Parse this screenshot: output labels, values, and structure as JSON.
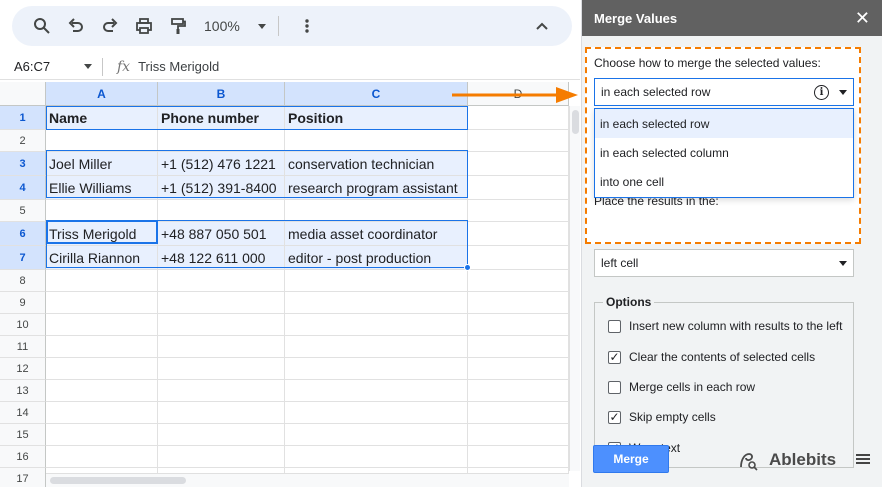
{
  "toolbar": {
    "zoom": "100%"
  },
  "formula_bar": {
    "name_box": "A6:C7",
    "fx": "fx",
    "value": "Triss Merigold"
  },
  "columns": [
    "A",
    "B",
    "C",
    "D"
  ],
  "rows": [
    {
      "num": "1",
      "cells": [
        "Name",
        "Phone number",
        "Position"
      ]
    },
    {
      "num": "2",
      "cells": [
        "",
        "",
        ""
      ]
    },
    {
      "num": "3",
      "cells": [
        "Joel Miller",
        "+1 (512) 476 1221",
        "conservation technician"
      ]
    },
    {
      "num": "4",
      "cells": [
        "Ellie Williams",
        "+1 (512) 391-8400",
        "research program assistant"
      ]
    },
    {
      "num": "5",
      "cells": [
        "",
        "",
        ""
      ]
    },
    {
      "num": "6",
      "cells": [
        "Triss Merigold",
        "+48 887 050 501",
        "media asset coordinator"
      ]
    },
    {
      "num": "7",
      "cells": [
        "Cirilla Riannon",
        "+48 122 611 000",
        "editor - post production"
      ]
    },
    {
      "num": "8",
      "cells": [
        "",
        "",
        ""
      ]
    },
    {
      "num": "9",
      "cells": [
        "",
        "",
        ""
      ]
    },
    {
      "num": "10",
      "cells": [
        "",
        "",
        ""
      ]
    },
    {
      "num": "11",
      "cells": [
        "",
        "",
        ""
      ]
    },
    {
      "num": "12",
      "cells": [
        "",
        "",
        ""
      ]
    },
    {
      "num": "13",
      "cells": [
        "",
        "",
        ""
      ]
    },
    {
      "num": "14",
      "cells": [
        "",
        "",
        ""
      ]
    },
    {
      "num": "15",
      "cells": [
        "",
        "",
        ""
      ]
    },
    {
      "num": "16",
      "cells": [
        "",
        "",
        ""
      ]
    },
    {
      "num": "17",
      "cells": [
        "",
        "",
        ""
      ]
    }
  ],
  "sidebar": {
    "title": "Merge Values",
    "merge_label": "Choose how to merge the selected values:",
    "merge_selected": "in each selected row",
    "merge_options": [
      "in each selected row",
      "in each selected column",
      "into one cell"
    ],
    "place_label": "Place the results in the:",
    "place_selected": "left cell",
    "options_title": "Options",
    "options": [
      {
        "label": "Insert new column with results to the left",
        "checked": false
      },
      {
        "label": "Clear the contents of selected cells",
        "checked": true
      },
      {
        "label": "Merge cells in each row",
        "checked": false
      },
      {
        "label": "Skip empty cells",
        "checked": true
      },
      {
        "label": "Wrap text",
        "checked": true
      }
    ],
    "merge_button": "Merge",
    "brand": "Ablebits"
  },
  "colors": {
    "accent": "#1a73e8",
    "highlight": "#f57c00",
    "button": "#4d90fe"
  }
}
